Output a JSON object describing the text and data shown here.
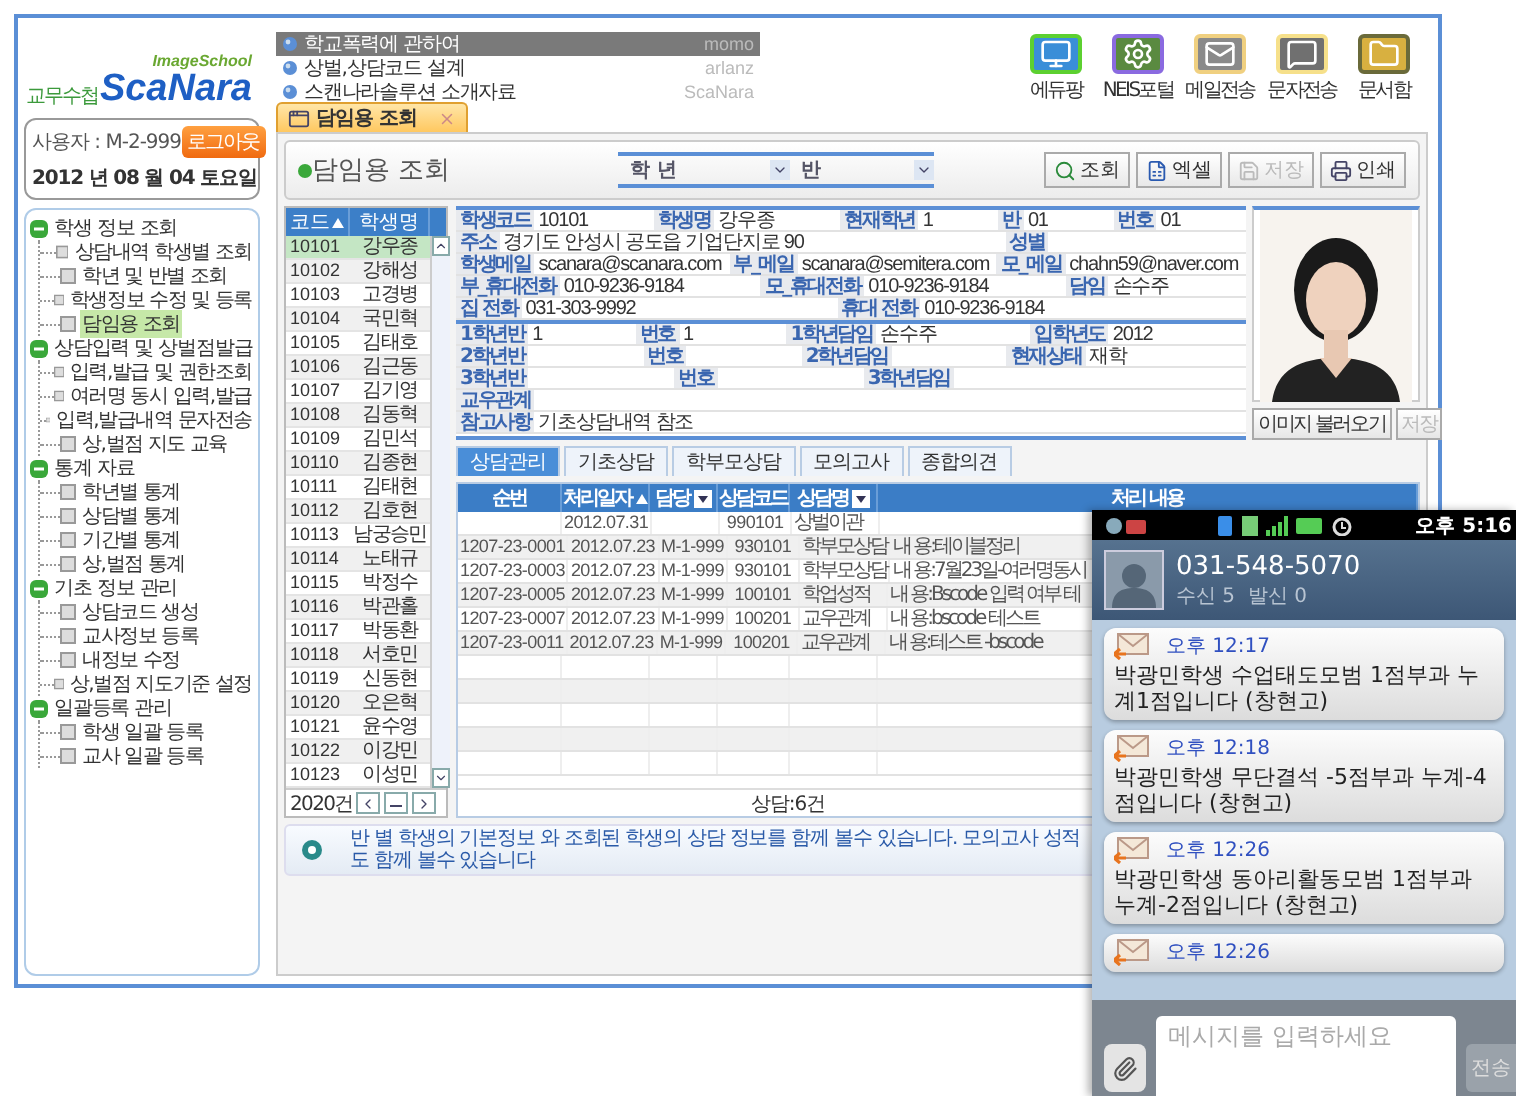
{
  "logo": {
    "tagline": "ImageSchool",
    "prefix": "교무수첩",
    "brand": "ScaNara"
  },
  "user": {
    "label": "사용자 : M-2-999",
    "logout": "로그아웃",
    "date": "2012 년 08 월 04  토요일"
  },
  "menu": [
    {
      "label": "학생 정보 조회",
      "expanded": true,
      "children": [
        {
          "label": "상담내역 학생별 조회",
          "selected": false
        },
        {
          "label": "학년 및 반별 조회",
          "selected": false
        },
        {
          "label": "학생정보 수정 및 등록",
          "selected": false
        },
        {
          "label": "담임용 조회",
          "selected": true
        }
      ]
    },
    {
      "label": "상담입력 및 상벌점발급",
      "expanded": true,
      "children": [
        {
          "label": "입력,발급 및 권한조회",
          "selected": false
        },
        {
          "label": "여러명 동시 입력,발급",
          "selected": false
        },
        {
          "label": "입력,발급내역 문자전송",
          "selected": false
        },
        {
          "label": "상,벌점 지도 교육",
          "selected": false
        }
      ]
    },
    {
      "label": "통계 자료",
      "expanded": true,
      "children": [
        {
          "label": "학년별 통계",
          "selected": false
        },
        {
          "label": "상담별 통계",
          "selected": false
        },
        {
          "label": "기간별 통계",
          "selected": false
        },
        {
          "label": "상,벌점 통계",
          "selected": false
        }
      ]
    },
    {
      "label": "기초 정보 관리",
      "expanded": true,
      "children": [
        {
          "label": "상담코드 생성",
          "selected": false
        },
        {
          "label": "교사정보 등록",
          "selected": false
        },
        {
          "label": "내정보 수정",
          "selected": false
        },
        {
          "label": "상,벌점 지도기준 설정",
          "selected": false
        }
      ]
    },
    {
      "label": "일괄등록 관리",
      "expanded": true,
      "children": [
        {
          "label": "학생 일괄 등록",
          "selected": false
        },
        {
          "label": "교사 일괄 등록",
          "selected": false
        }
      ]
    }
  ],
  "notices": [
    {
      "title": "학교폭력에 관하여",
      "author": "momo",
      "highlighted": true
    },
    {
      "title": "상벌,상담코드 설계",
      "author": "arlanz",
      "highlighted": false
    },
    {
      "title": "스캔나라솔루션 소개자료",
      "author": "ScaNara",
      "highlighted": false
    }
  ],
  "shortcuts": [
    {
      "label": "에듀팡",
      "kind": "monitor"
    },
    {
      "label": "NEIS포털",
      "kind": "gear"
    },
    {
      "label": "메일전송",
      "kind": "mail"
    },
    {
      "label": "문자전송",
      "kind": "message"
    },
    {
      "label": "문서함",
      "kind": "folder"
    }
  ],
  "tab": {
    "label": "담임용 조회"
  },
  "panel": {
    "title": "담임용 조회",
    "filters": [
      {
        "label": "학 년"
      },
      {
        "label": "반"
      }
    ],
    "buttons": [
      {
        "label": "조회",
        "kind": "search",
        "disabled": false
      },
      {
        "label": "엑셀",
        "kind": "excel",
        "disabled": false
      },
      {
        "label": "저장",
        "kind": "save",
        "disabled": true
      },
      {
        "label": "인쇄",
        "kind": "print",
        "disabled": false
      }
    ]
  },
  "student_list": {
    "columns": [
      {
        "label": "코드",
        "sorted": true
      },
      {
        "label": "학생명",
        "sorted": false
      }
    ],
    "count": "2020건",
    "rows": [
      {
        "code": "10101",
        "name": "강우종",
        "selected": true
      },
      {
        "code": "10102",
        "name": "강해성",
        "selected": false
      },
      {
        "code": "10103",
        "name": "고경병",
        "selected": false
      },
      {
        "code": "10104",
        "name": "국민혁",
        "selected": false
      },
      {
        "code": "10105",
        "name": "김태호",
        "selected": false
      },
      {
        "code": "10106",
        "name": "김근동",
        "selected": false
      },
      {
        "code": "10107",
        "name": "김기영",
        "selected": false
      },
      {
        "code": "10108",
        "name": "김동혁",
        "selected": false
      },
      {
        "code": "10109",
        "name": "김민석",
        "selected": false
      },
      {
        "code": "10110",
        "name": "김종현",
        "selected": false
      },
      {
        "code": "10111",
        "name": "김태현",
        "selected": false
      },
      {
        "code": "10112",
        "name": "김호현",
        "selected": false
      },
      {
        "code": "10113",
        "name": "남궁승민",
        "selected": false
      },
      {
        "code": "10114",
        "name": "노태규",
        "selected": false
      },
      {
        "code": "10115",
        "name": "박정수",
        "selected": false
      },
      {
        "code": "10116",
        "name": "박관홀",
        "selected": false
      },
      {
        "code": "10117",
        "name": "박동환",
        "selected": false
      },
      {
        "code": "10118",
        "name": "서호민",
        "selected": false
      },
      {
        "code": "10119",
        "name": "신동현",
        "selected": false
      },
      {
        "code": "10120",
        "name": "오은혁",
        "selected": false
      },
      {
        "code": "10121",
        "name": "윤수영",
        "selected": false
      },
      {
        "code": "10122",
        "name": "이강민",
        "selected": false
      },
      {
        "code": "10123",
        "name": "이성민",
        "selected": false
      }
    ]
  },
  "student_info": {
    "sections": [
      [
        [
          {
            "kind": "label",
            "text": "학생코드"
          },
          {
            "kind": "value",
            "text": "10101"
          },
          {
            "kind": "label",
            "text": "학생명"
          },
          {
            "kind": "value",
            "text": "강우종"
          },
          {
            "kind": "label",
            "text": "현재학년"
          },
          {
            "kind": "value",
            "text": "1"
          },
          {
            "kind": "label",
            "text": "반"
          },
          {
            "kind": "value",
            "text": "01"
          },
          {
            "kind": "label",
            "text": "번호"
          },
          {
            "kind": "value",
            "text": "01"
          }
        ],
        [
          {
            "kind": "label",
            "text": "주소"
          },
          {
            "kind": "value",
            "text": "경기도 안성시 공도읍 기업단지로 90"
          },
          {
            "kind": "label",
            "text": "성별"
          },
          {
            "kind": "blank"
          }
        ],
        [
          {
            "kind": "label",
            "text": "학생메일"
          },
          {
            "kind": "value",
            "text": "scanara@scanara.com"
          },
          {
            "kind": "label",
            "text": "부_메일"
          },
          {
            "kind": "value",
            "text": "scanara@semitera.com"
          },
          {
            "kind": "label",
            "text": "모_메일"
          },
          {
            "kind": "value",
            "text": "chahn59@naver.com"
          }
        ],
        [
          {
            "kind": "label",
            "text": "부_휴대전화"
          },
          {
            "kind": "value",
            "text": "010-9236-9184"
          },
          {
            "kind": "label",
            "text": "모_휴대전화"
          },
          {
            "kind": "value",
            "text": "010-9236-9184"
          },
          {
            "kind": "label",
            "text": "담임"
          },
          {
            "kind": "value",
            "text": "손수주"
          }
        ],
        [
          {
            "kind": "label",
            "text": "집 전화"
          },
          {
            "kind": "value",
            "text": "031-303-9992"
          },
          {
            "kind": "label",
            "text": "휴대 전화"
          },
          {
            "kind": "value",
            "text": "010-9236-9184"
          }
        ]
      ],
      [
        [
          {
            "kind": "label",
            "text": "1학년반"
          },
          {
            "kind": "value",
            "text": "1"
          },
          {
            "kind": "label",
            "text": "번호"
          },
          {
            "kind": "value",
            "text": "1"
          },
          {
            "kind": "label",
            "text": "1학년담임"
          },
          {
            "kind": "value",
            "text": "손수주"
          },
          {
            "kind": "label",
            "text": "입학년도"
          },
          {
            "kind": "value",
            "text": "2012"
          }
        ],
        [
          {
            "kind": "label",
            "text": "2학년반"
          },
          {
            "kind": "blank"
          },
          {
            "kind": "label",
            "text": "번호"
          },
          {
            "kind": "blank"
          },
          {
            "kind": "label",
            "text": "2학년담임"
          },
          {
            "kind": "blank"
          },
          {
            "kind": "label",
            "text": "현재상태"
          },
          {
            "kind": "value",
            "text": "재학"
          }
        ],
        [
          {
            "kind": "label",
            "text": "3학년반"
          },
          {
            "kind": "blank"
          },
          {
            "kind": "label",
            "text": "번호"
          },
          {
            "kind": "blank"
          },
          {
            "kind": "label",
            "text": "3학년담임"
          },
          {
            "kind": "blank"
          },
          {
            "kind": "blank"
          }
        ],
        [
          {
            "kind": "label",
            "text": "교우관계"
          },
          {
            "kind": "blank"
          }
        ],
        [
          {
            "kind": "label",
            "text": "참고사항"
          },
          {
            "kind": "value",
            "text": "기초상담내역 참조"
          }
        ]
      ]
    ]
  },
  "photo_buttons": [
    {
      "label": "이미지 불러오기",
      "disabled": false
    },
    {
      "label": "저장",
      "disabled": true
    }
  ],
  "subtabs": [
    {
      "label": "상담관리",
      "selected": true
    },
    {
      "label": "기초상담",
      "selected": false
    },
    {
      "label": "학부모상담",
      "selected": false
    },
    {
      "label": "모의고사",
      "selected": false
    },
    {
      "label": "종합의견",
      "selected": false
    }
  ],
  "consult_table": {
    "columns": [
      {
        "label": "순번",
        "sorted": false,
        "filter": false
      },
      {
        "label": "처리일자",
        "sorted": true,
        "filter": false
      },
      {
        "label": "담당",
        "sorted": false,
        "filter": true
      },
      {
        "label": "상담코드",
        "sorted": false,
        "filter": false
      },
      {
        "label": "상담명",
        "sorted": false,
        "filter": true
      },
      {
        "label": "처리 내용",
        "sorted": false,
        "filter": false
      }
    ],
    "rows": [
      {
        "cells": [
          {
            "kind": "blank"
          },
          {
            "kind": "text",
            "text": "2012.07.31"
          },
          {
            "kind": "blank"
          },
          {
            "kind": "text",
            "text": "990101"
          },
          {
            "kind": "text",
            "text": "상벌이관"
          },
          {
            "kind": "blank"
          }
        ]
      },
      {
        "cells": [
          {
            "kind": "text",
            "text": "1207-23-0001"
          },
          {
            "kind": "text",
            "text": "2012.07.23"
          },
          {
            "kind": "text",
            "text": "M-1-999"
          },
          {
            "kind": "text",
            "text": "930101"
          },
          {
            "kind": "text",
            "text": "학부모상담"
          },
          {
            "kind": "text",
            "text": "내 용:테이블정리"
          }
        ]
      },
      {
        "cells": [
          {
            "kind": "text",
            "text": "1207-23-0003"
          },
          {
            "kind": "text",
            "text": "2012.07.23"
          },
          {
            "kind": "text",
            "text": "M-1-999"
          },
          {
            "kind": "text",
            "text": "930101"
          },
          {
            "kind": "text",
            "text": "학부모상담"
          },
          {
            "kind": "text",
            "text": "내 용:7월23일-여러명동시"
          }
        ]
      },
      {
        "cells": [
          {
            "kind": "text",
            "text": "1207-23-0005"
          },
          {
            "kind": "text",
            "text": "2012.07.23"
          },
          {
            "kind": "text",
            "text": "M-1-999"
          },
          {
            "kind": "text",
            "text": "100101"
          },
          {
            "kind": "text",
            "text": "학업성적"
          },
          {
            "kind": "text",
            "text": "내 용:Bscode 입력 여부 테"
          }
        ]
      },
      {
        "cells": [
          {
            "kind": "text",
            "text": "1207-23-0007"
          },
          {
            "kind": "text",
            "text": "2012.07.23"
          },
          {
            "kind": "text",
            "text": "M-1-999"
          },
          {
            "kind": "text",
            "text": "100201"
          },
          {
            "kind": "text",
            "text": "교우관계"
          },
          {
            "kind": "text",
            "text": "내 용:bscode 테스트"
          }
        ]
      },
      {
        "cells": [
          {
            "kind": "text",
            "text": "1207-23-0011"
          },
          {
            "kind": "text",
            "text": "2012.07.23"
          },
          {
            "kind": "text",
            "text": "M-1-999"
          },
          {
            "kind": "text",
            "text": "100201"
          },
          {
            "kind": "text",
            "text": "교우관계"
          },
          {
            "kind": "text",
            "text": "내 용:테스트 -bscode"
          }
        ]
      }
    ],
    "summary": "상담:6건"
  },
  "hint": "반 별 학생의 기본정보 와 조회된 학생의 상담 정보를 함께 볼수 있습니다. 모의고사 성적 도 함께 볼수 있습니다",
  "phone": {
    "time": "오후 5:16",
    "contact": "031-548-5070",
    "counts": "수신 5  발신 0",
    "messages": [
      {
        "time": "오후 12:17",
        "text": "박광민학생 수업태도모범 1점부과 누계1점입니다 (창현고)"
      },
      {
        "time": "오후 12:18",
        "text": "박광민학생 무단결석 -5점부과 누계-4점입니다 (창현고)"
      },
      {
        "time": "오후 12:26",
        "text": "박광민학생 동아리활동모범 1점부과 누계-2점입니다 (창현고)"
      },
      {
        "time": "오후 12:26"
      }
    ],
    "placeholder": "메시지를 입력하세요",
    "send": "전송"
  }
}
